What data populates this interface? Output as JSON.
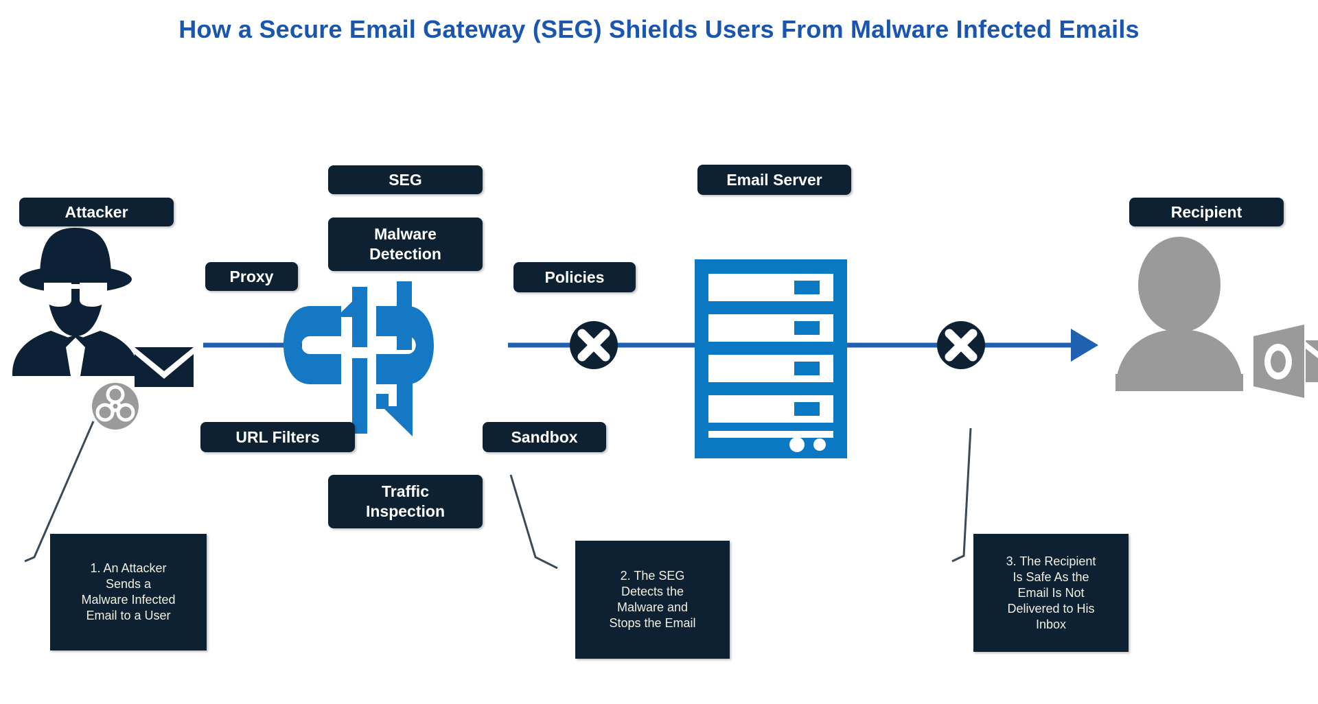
{
  "page": {
    "title": "How a Secure Email Gateway (SEG) Shields Users From Malware Infected Emails",
    "background_color": "#ffffff",
    "title_color": "#1a56b0"
  },
  "colors": {
    "dark_navy": "#0d2133",
    "brand_blue": "#1478c4",
    "line_blue": "#2060b0",
    "caption_text": "#f2f0e2",
    "gray_icon": "#999999",
    "leader_line": "#3b4a57"
  },
  "nodes": {
    "attacker": {
      "label": "Attacker",
      "icon": "spy-attacker-icon"
    },
    "proxy": {
      "label": "Proxy"
    },
    "seg": {
      "label": "SEG",
      "icon": "secure-email-gateway-icon"
    },
    "malware_detection": {
      "label": "Malware\nDetection"
    },
    "url_filters": {
      "label": "URL Filters"
    },
    "traffic_inspection": {
      "label": "Traffic\nInspection"
    },
    "policies": {
      "label": "Policies"
    },
    "sandbox": {
      "label": "Sandbox"
    },
    "email_server": {
      "label": "Email Server",
      "icon": "server-rack-icon"
    },
    "recipient": {
      "label": "Recipient",
      "icon": "user-with-mail-icon"
    }
  },
  "blockers": [
    {
      "name": "block-x-after-seg",
      "symbol": "X"
    },
    {
      "name": "block-x-after-server",
      "symbol": "X"
    }
  ],
  "badges": {
    "malware": {
      "name": "biohazard-icon",
      "symbol": "biohazard"
    },
    "envelope": {
      "name": "envelope-icon",
      "symbol": "envelope"
    }
  },
  "captions": [
    {
      "id": "caption-1",
      "text": "1. An Attacker\nSends a\nMalware Infected\nEmail to a User"
    },
    {
      "id": "caption-2",
      "text": "2. The SEG\nDetects the\nMalware and\nStops the Email"
    },
    {
      "id": "caption-3",
      "text": "3. The Recipient\nIs Safe As the\nEmail Is Not\nDelivered to His\nInbox"
    }
  ]
}
